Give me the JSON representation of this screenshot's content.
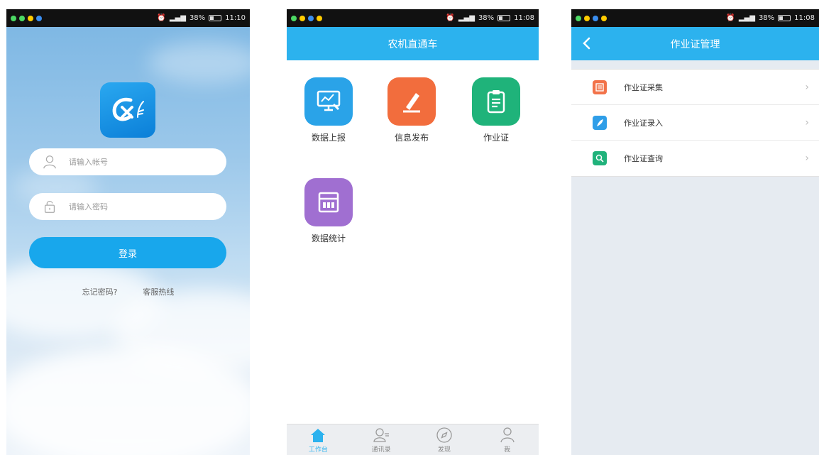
{
  "status": {
    "screen1": {
      "battery": "38%",
      "time": "11:10"
    },
    "screen2": {
      "battery": "38%",
      "time": "11:08"
    },
    "screen3": {
      "battery": "38%",
      "time": "11:08"
    }
  },
  "login": {
    "account_placeholder": "请输入帐号",
    "password_placeholder": "请输入密码",
    "login_label": "登录",
    "forgot_label": "忘记密码?",
    "hotline_label": "客服热线"
  },
  "workbench": {
    "title": "农机直通车",
    "tiles": [
      {
        "label": "数据上报",
        "color": "#2aa3e8",
        "icon": "monitor-chart-icon"
      },
      {
        "label": "信息发布",
        "color": "#f26d3d",
        "icon": "pencil-icon"
      },
      {
        "label": "作业证",
        "color": "#1fb37a",
        "icon": "clipboard-icon"
      },
      {
        "label": "数据统计",
        "color": "#a06fd1",
        "icon": "calculator-icon"
      }
    ],
    "tabs": [
      {
        "label": "工作台",
        "icon": "home-icon"
      },
      {
        "label": "通讯录",
        "icon": "contacts-icon"
      },
      {
        "label": "发现",
        "icon": "compass-icon"
      },
      {
        "label": "我",
        "icon": "person-icon"
      }
    ]
  },
  "cert": {
    "title": "作业证管理",
    "items": [
      {
        "label": "作业证采集",
        "color": "#f2734a",
        "icon": "scan-icon"
      },
      {
        "label": "作业证录入",
        "color": "#2f9ee8",
        "icon": "feather-icon"
      },
      {
        "label": "作业证查询",
        "color": "#20b27b",
        "icon": "search-icon"
      }
    ]
  }
}
